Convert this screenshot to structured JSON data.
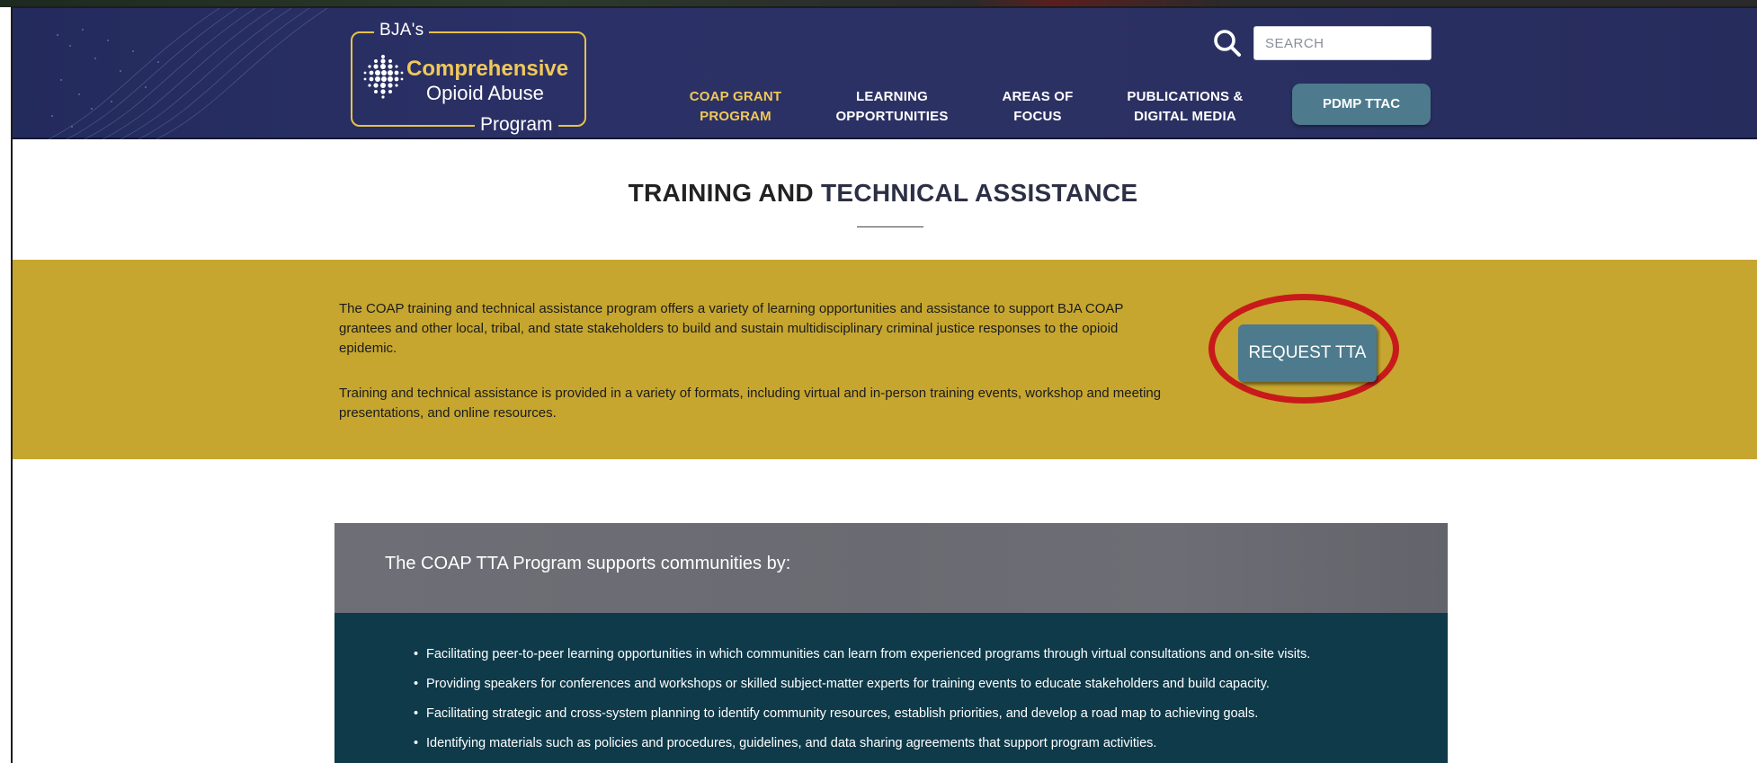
{
  "header": {
    "logo": {
      "prefix": "BJA's",
      "line1": "Comprehensive",
      "line2": "Opioid Abuse",
      "line3": "Program"
    },
    "search_placeholder": "SEARCH",
    "nav": [
      {
        "line1": "COAP GRANT",
        "line2": "PROGRAM",
        "active": true
      },
      {
        "line1": "LEARNING",
        "line2": "OPPORTUNITIES",
        "active": false
      },
      {
        "line1": "AREAS OF",
        "line2": "FOCUS",
        "active": false
      },
      {
        "line1": "PUBLICATIONS &",
        "line2": "DIGITAL MEDIA",
        "active": false
      }
    ],
    "pdmp_label": "PDMP TTAC"
  },
  "title": {
    "part1": "TRAINING AND ",
    "part2": "TECHNICAL ASSISTANCE"
  },
  "intro": {
    "p1": "The COAP training and technical assistance program offers a variety of learning opportunities and assistance to support BJA COAP grantees and other local, tribal, and state stakeholders to build and sustain multidisciplinary criminal justice responses to the opioid epidemic.",
    "p2": "Training and technical assistance is provided in a variety of formats, including virtual and in-person training events, workshop and meeting presentations, and online resources.",
    "request_button": "REQUEST TTA"
  },
  "communities": {
    "heading": "The COAP TTA Program supports communities by:",
    "items": [
      "Facilitating peer-to-peer learning opportunities in which communities can learn from experienced programs through virtual consultations and on-site visits.",
      "Providing speakers for conferences and workshops or skilled subject-matter experts for training events to educate stakeholders and build capacity.",
      "Facilitating strategic and cross-system planning to identify community resources, establish priorities, and develop a road map to achieving goals.",
      "Identifying materials such as policies and procedures, guidelines, and data sharing agreements that support program activities."
    ]
  },
  "colors": {
    "header_bg": "#2a3064",
    "accent_gold": "#c6a62f",
    "logo_gold": "#f0c85a",
    "button_teal": "#4d7a8c",
    "highlight_red": "#c81a1a",
    "list_bg": "#0e3a4a"
  },
  "icons": {
    "search": "search-icon",
    "logo_mark": "dot-sphere-logo-icon"
  }
}
